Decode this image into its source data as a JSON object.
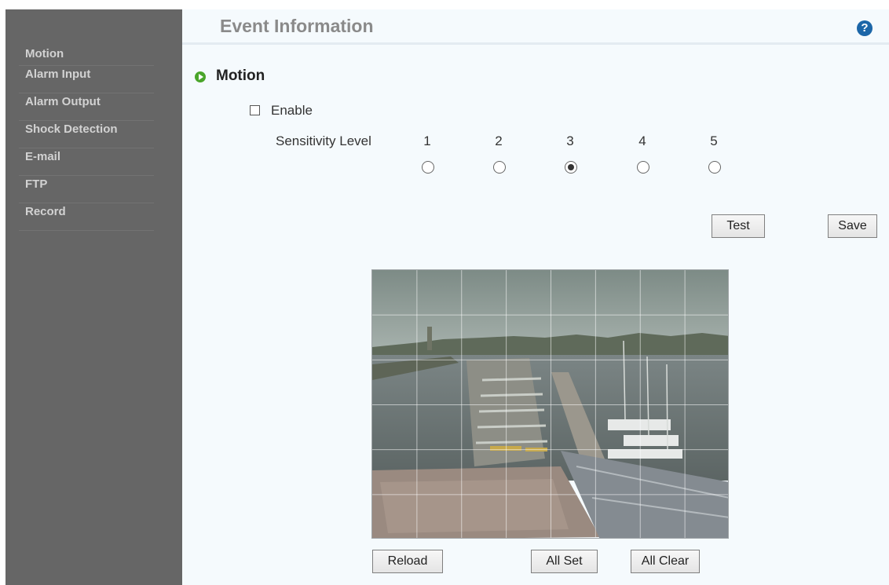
{
  "sidebar": {
    "items": [
      {
        "id": "motion",
        "label": "Motion"
      },
      {
        "id": "alarm-input",
        "label": "Alarm Input"
      },
      {
        "id": "alarm-output",
        "label": "Alarm Output"
      },
      {
        "id": "shock-detection",
        "label": "Shock Detection"
      },
      {
        "id": "email",
        "label": "E-mail"
      },
      {
        "id": "ftp",
        "label": "FTP"
      },
      {
        "id": "record",
        "label": "Record"
      }
    ]
  },
  "header": {
    "title": "Event Information",
    "help_icon": "question-circle-icon"
  },
  "section": {
    "title": "Motion",
    "icon": "play-circle-icon"
  },
  "enable": {
    "label": "Enable",
    "checked": false
  },
  "sensitivity": {
    "label": "Sensitivity Level",
    "levels": [
      "1",
      "2",
      "3",
      "4",
      "5"
    ],
    "selected": "3"
  },
  "buttons": {
    "test": "Test",
    "save": "Save",
    "reload": "Reload",
    "all_set": "All Set",
    "all_clear": "All Clear"
  },
  "camera": {
    "grid_columns": 8,
    "grid_rows": 6
  },
  "colors": {
    "sidebar_bg": "#666666",
    "accent_green": "#4aa52a",
    "help_blue": "#1c66a8",
    "title_gray": "#8a8a8a"
  }
}
